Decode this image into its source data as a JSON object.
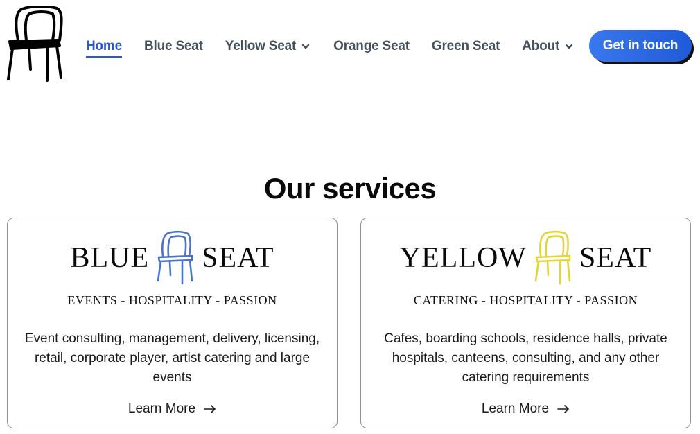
{
  "nav": {
    "items": [
      {
        "label": "Home",
        "active": true
      },
      {
        "label": "Blue Seat"
      },
      {
        "label": "Yellow Seat",
        "dropdown": true
      },
      {
        "label": "Orange Seat"
      },
      {
        "label": "Green Seat"
      },
      {
        "label": "About",
        "dropdown": true
      }
    ],
    "cta": "Get in touch"
  },
  "colors": {
    "accent": "#2f57c9",
    "cta": "#2563eb",
    "blue_chair": "#4a74c9",
    "yellow_chair": "#e8dc3a"
  },
  "services": {
    "title": "Our services",
    "cards": [
      {
        "brand_left": "BLUE",
        "brand_right": "SEAT",
        "tagline": "EVENTS - HOSPITALITY - PASSION",
        "description": "Event consulting, management, delivery, licensing, retail, corporate player, artist catering and large events",
        "link": "Learn More"
      },
      {
        "brand_left": "YELLOW",
        "brand_right": "SEAT",
        "tagline": "CATERING - HOSPITALITY - PASSION",
        "description": "Cafes, boarding schools, residence halls, private hospitals, canteens, consulting, and any other catering requirements",
        "link": "Learn More"
      }
    ]
  }
}
